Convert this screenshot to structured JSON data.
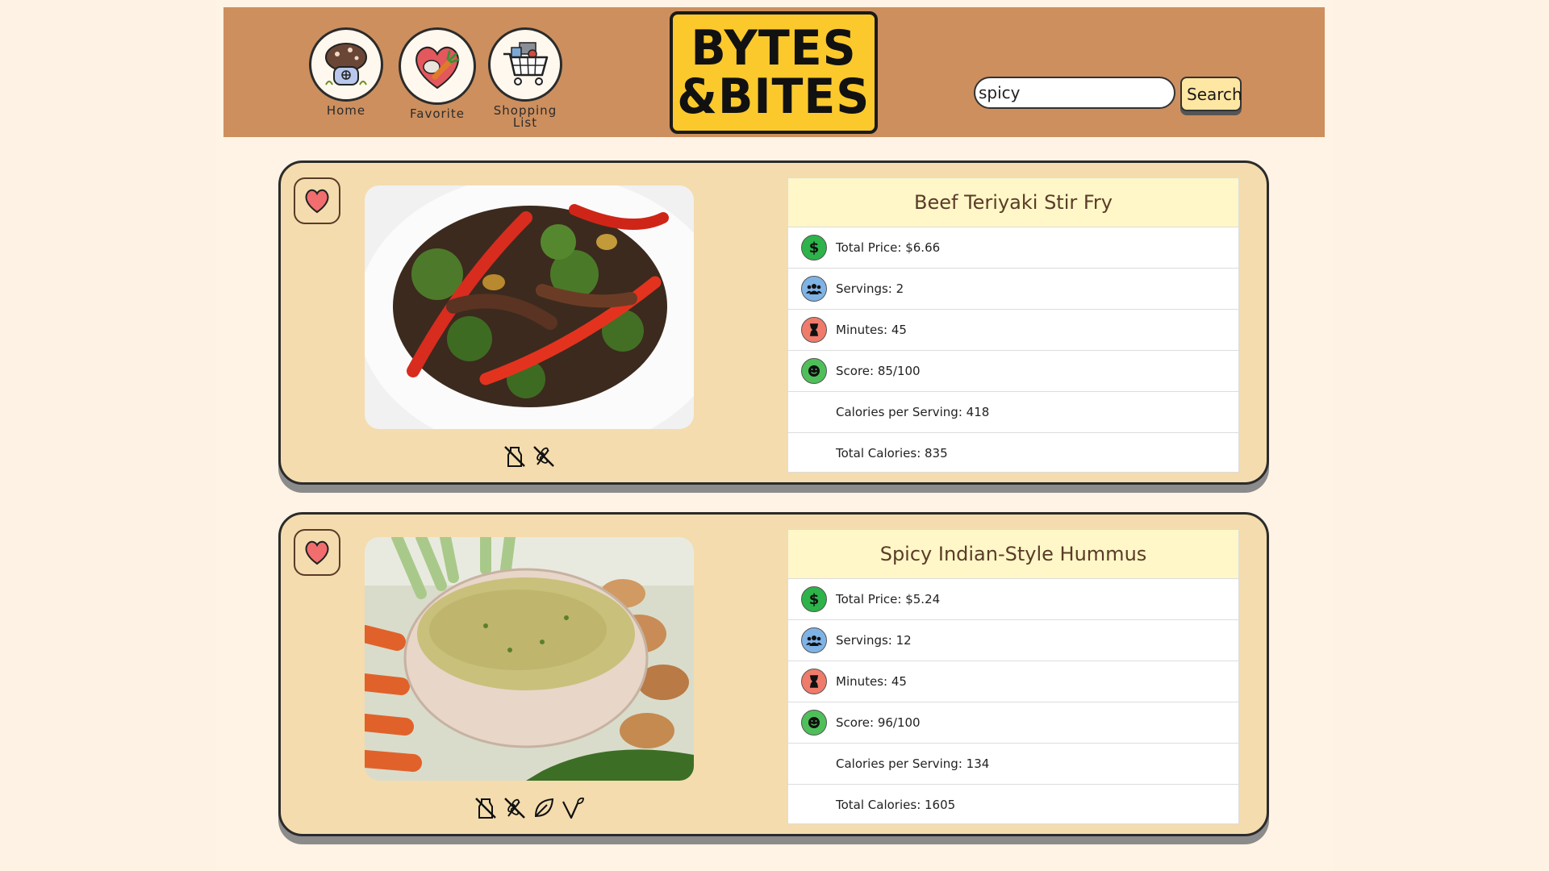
{
  "nav": {
    "home_label": "Home",
    "favorite_label": "Favorite",
    "shopping_label": "Shopping\nList"
  },
  "logo": {
    "line1": "BYTES",
    "line2": "&BITES"
  },
  "search": {
    "value": "spicy",
    "button_label": "Search"
  },
  "colors": {
    "header": "#cd8f5e",
    "card": "#f4dcae",
    "title_bar": "#fff7c7",
    "logo": "#fbc92c",
    "price_icon": "#2db34a",
    "servings_icon": "#7fb3e6",
    "minutes_icon": "#ef7b6b",
    "score_icon": "#4fbf5a"
  },
  "recipes": [
    {
      "title": "Beef Teriyaki Stir Fry",
      "favorite_icon": "heart-icon",
      "diet_icons": [
        "dairy-free-icon",
        "gluten-free-icon"
      ],
      "price": "Total Price: $6.66",
      "servings": "Servings: 2",
      "minutes": "Minutes: 45",
      "score": "Score: 85/100",
      "calories_per_serving": "Calories per Serving: 418",
      "total_calories": "Total Calories: 835"
    },
    {
      "title": "Spicy Indian-Style Hummus",
      "favorite_icon": "heart-icon",
      "diet_icons": [
        "dairy-free-icon",
        "gluten-free-icon",
        "vegan-icon",
        "vegetarian-icon"
      ],
      "price": "Total Price: $5.24",
      "servings": "Servings: 12",
      "minutes": "Minutes: 45",
      "score": "Score: 96/100",
      "calories_per_serving": "Calories per Serving: 134",
      "total_calories": "Total Calories: 1605"
    }
  ]
}
